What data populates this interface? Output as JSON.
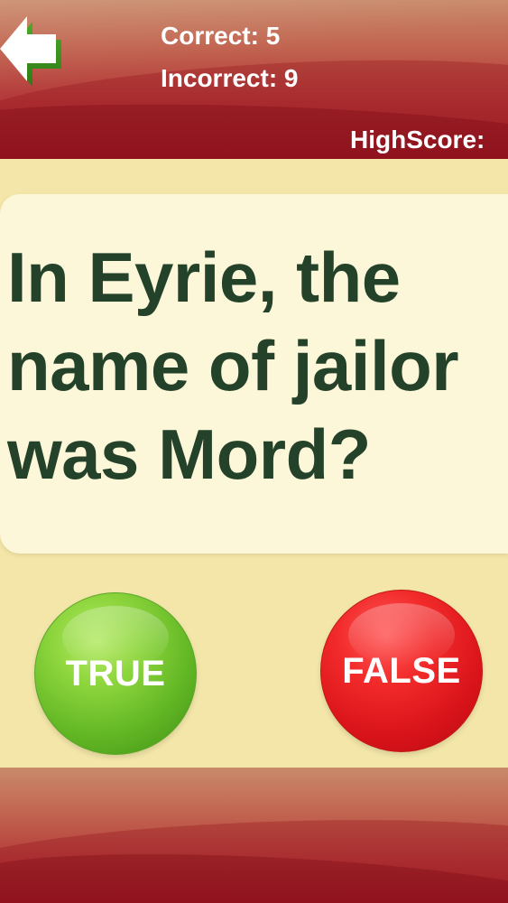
{
  "header": {
    "correct_label": "Correct: 5",
    "incorrect_label": "Incorrect: 9",
    "highscore_label": "HighScore:",
    "back_icon": "back-arrow-icon"
  },
  "question": {
    "text": "In Eyrie, the name of jailor was Mord?"
  },
  "answers": {
    "true_label": "TRUE",
    "false_label": "FALSE"
  },
  "colors": {
    "header_red": "#b4393a",
    "background": "#f3e6a8",
    "card": "#fcf7d9",
    "question_text": "#24412a",
    "true_green": "#63b825",
    "false_red": "#d9141a"
  }
}
